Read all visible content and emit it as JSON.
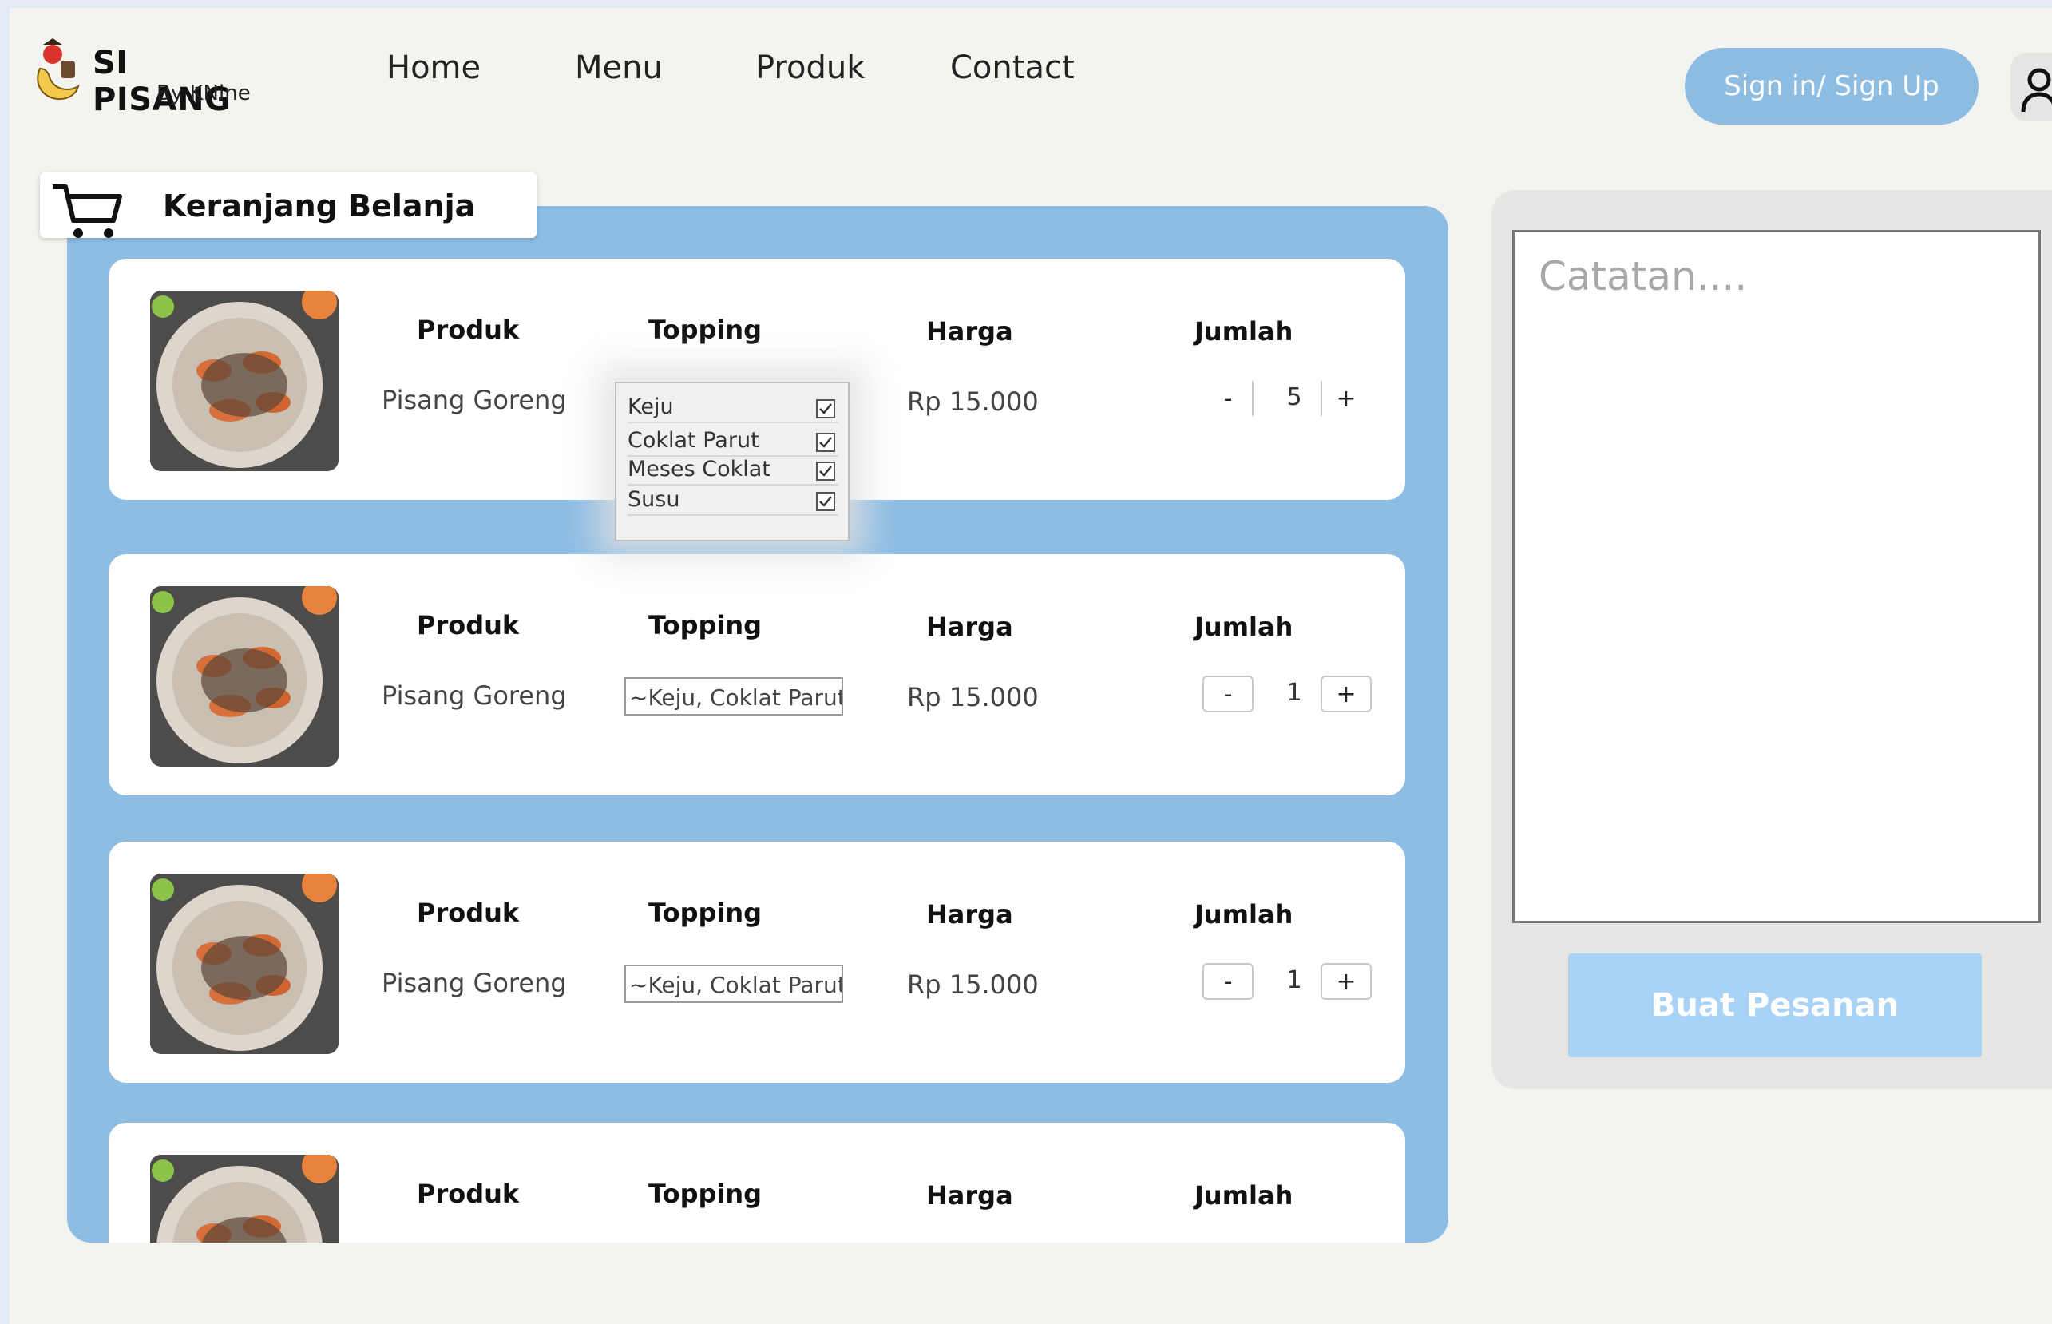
{
  "brand": {
    "title": "SI PISANG",
    "subtitle": "By KNine"
  },
  "nav": {
    "items": [
      "Home",
      "Menu",
      "Produk",
      "Contact"
    ]
  },
  "header": {
    "signin_label": "Sign in/ Sign Up"
  },
  "cart": {
    "title": "Keranjang Belanja",
    "headers": {
      "product": "Produk",
      "topping": "Topping",
      "price": "Harga",
      "qty": "Jumlah"
    },
    "items": [
      {
        "product": "Pisang Goreng",
        "topping": "",
        "price": "Rp 15.000",
        "qty": "5",
        "minus": "-",
        "plus": "+"
      },
      {
        "product": "Pisang Goreng",
        "topping": "~Keju, Coklat Parut,",
        "price": "Rp 15.000",
        "qty": "1",
        "minus": "-",
        "plus": "+"
      },
      {
        "product": "Pisang Goreng",
        "topping": "~Keju, Coklat Parut,",
        "price": "Rp 15.000",
        "qty": "1",
        "minus": "-",
        "plus": "+"
      }
    ]
  },
  "topping_dropdown": {
    "options": [
      {
        "label": "Keju",
        "checked": true
      },
      {
        "label": "Coklat Parut",
        "checked": true
      },
      {
        "label": "Meses Coklat",
        "checked": true
      },
      {
        "label": "Susu",
        "checked": true
      }
    ]
  },
  "notes": {
    "placeholder": "Catatan....",
    "submit_label": "Buat Pesanan"
  },
  "colors": {
    "accent": "#8dbde3",
    "button_light": "#a9d3f6",
    "background": "#f3f3ef"
  },
  "icons": {
    "cart": "shopping-cart-icon",
    "user": "user-icon",
    "check": "checkbox-checked-icon"
  }
}
